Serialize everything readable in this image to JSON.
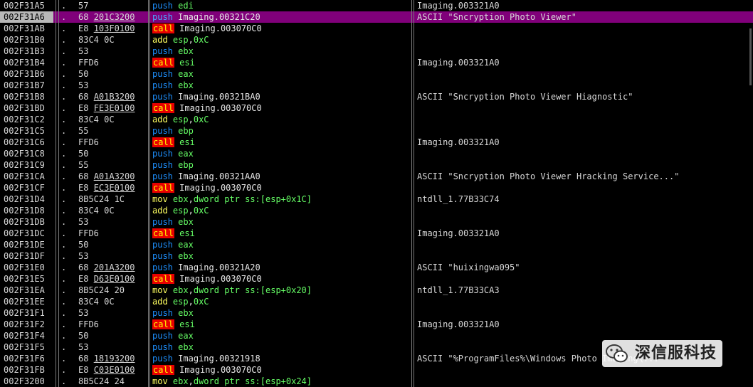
{
  "rows": [
    {
      "addr": "002F31A5",
      "mark": ".",
      "hex": [
        {
          "t": "57"
        }
      ],
      "op": "push",
      "args": [
        {
          "t": "edi",
          "k": "reg"
        }
      ],
      "comment": "Imaging.003321A0"
    },
    {
      "addr": "002F31A6",
      "mark": ".",
      "hex": [
        {
          "t": "68 "
        },
        {
          "t": "201C3200",
          "u": true
        }
      ],
      "op": "push",
      "args": [
        {
          "t": "Imaging.00321C20",
          "k": "lbl"
        }
      ],
      "comment": "ASCII \"Sncryption Photo Viewer\"",
      "selected": true
    },
    {
      "addr": "002F31AB",
      "mark": ".",
      "hex": [
        {
          "t": "E8 "
        },
        {
          "t": "103F0100",
          "u": true
        }
      ],
      "op": "call",
      "args": [
        {
          "t": "Imaging.003070C0",
          "k": "lbl"
        }
      ],
      "comment": ""
    },
    {
      "addr": "002F31B0",
      "mark": ".",
      "hex": [
        {
          "t": "83C4 0C"
        }
      ],
      "op": "add",
      "args": [
        {
          "t": "esp",
          "k": "reg"
        },
        {
          "t": ",",
          "k": "tok"
        },
        {
          "t": "0xC",
          "k": "imm"
        }
      ],
      "comment": ""
    },
    {
      "addr": "002F31B3",
      "mark": ".",
      "hex": [
        {
          "t": "53"
        }
      ],
      "op": "push",
      "args": [
        {
          "t": "ebx",
          "k": "reg"
        }
      ],
      "comment": ""
    },
    {
      "addr": "002F31B4",
      "mark": ".",
      "hex": [
        {
          "t": "FFD6"
        }
      ],
      "op": "call",
      "args": [
        {
          "t": "esi",
          "k": "reg"
        }
      ],
      "comment": "Imaging.003321A0"
    },
    {
      "addr": "002F31B6",
      "mark": ".",
      "hex": [
        {
          "t": "50"
        }
      ],
      "op": "push",
      "args": [
        {
          "t": "eax",
          "k": "reg"
        }
      ],
      "comment": ""
    },
    {
      "addr": "002F31B7",
      "mark": ".",
      "hex": [
        {
          "t": "53"
        }
      ],
      "op": "push",
      "args": [
        {
          "t": "ebx",
          "k": "reg"
        }
      ],
      "comment": ""
    },
    {
      "addr": "002F31B8",
      "mark": ".",
      "hex": [
        {
          "t": "68 "
        },
        {
          "t": "A01B3200",
          "u": true
        }
      ],
      "op": "push",
      "args": [
        {
          "t": "Imaging.00321BA0",
          "k": "lbl"
        }
      ],
      "comment": "ASCII \"Sncryption Photo Viewer Hiagnostic\""
    },
    {
      "addr": "002F31BD",
      "mark": ".",
      "hex": [
        {
          "t": "E8 "
        },
        {
          "t": "FE3E0100",
          "u": true
        }
      ],
      "op": "call",
      "args": [
        {
          "t": "Imaging.003070C0",
          "k": "lbl"
        }
      ],
      "comment": ""
    },
    {
      "addr": "002F31C2",
      "mark": ".",
      "hex": [
        {
          "t": "83C4 0C"
        }
      ],
      "op": "add",
      "args": [
        {
          "t": "esp",
          "k": "reg"
        },
        {
          "t": ",",
          "k": "tok"
        },
        {
          "t": "0xC",
          "k": "imm"
        }
      ],
      "comment": ""
    },
    {
      "addr": "002F31C5",
      "mark": ".",
      "hex": [
        {
          "t": "55"
        }
      ],
      "op": "push",
      "args": [
        {
          "t": "ebp",
          "k": "reg"
        }
      ],
      "comment": ""
    },
    {
      "addr": "002F31C6",
      "mark": ".",
      "hex": [
        {
          "t": "FFD6"
        }
      ],
      "op": "call",
      "args": [
        {
          "t": "esi",
          "k": "reg"
        }
      ],
      "comment": "Imaging.003321A0"
    },
    {
      "addr": "002F31C8",
      "mark": ".",
      "hex": [
        {
          "t": "50"
        }
      ],
      "op": "push",
      "args": [
        {
          "t": "eax",
          "k": "reg"
        }
      ],
      "comment": ""
    },
    {
      "addr": "002F31C9",
      "mark": ".",
      "hex": [
        {
          "t": "55"
        }
      ],
      "op": "push",
      "args": [
        {
          "t": "ebp",
          "k": "reg"
        }
      ],
      "comment": ""
    },
    {
      "addr": "002F31CA",
      "mark": ".",
      "hex": [
        {
          "t": "68 "
        },
        {
          "t": "A01A3200",
          "u": true
        }
      ],
      "op": "push",
      "args": [
        {
          "t": "Imaging.00321AA0",
          "k": "lbl"
        }
      ],
      "comment": "ASCII \"Sncryption Photo Viewer Hracking Service...\""
    },
    {
      "addr": "002F31CF",
      "mark": ".",
      "hex": [
        {
          "t": "E8 "
        },
        {
          "t": "EC3E0100",
          "u": true
        }
      ],
      "op": "call",
      "args": [
        {
          "t": "Imaging.003070C0",
          "k": "lbl"
        }
      ],
      "comment": ""
    },
    {
      "addr": "002F31D4",
      "mark": ".",
      "hex": [
        {
          "t": "8B5C24 1C"
        }
      ],
      "op": "mov",
      "args": [
        {
          "t": "ebx",
          "k": "reg"
        },
        {
          "t": ",",
          "k": "tok"
        },
        {
          "t": "dword ptr ss:[esp+0x1C]",
          "k": "mem"
        }
      ],
      "comment": "ntdll_1.77B33C74"
    },
    {
      "addr": "002F31D8",
      "mark": ".",
      "hex": [
        {
          "t": "83C4 0C"
        }
      ],
      "op": "add",
      "args": [
        {
          "t": "esp",
          "k": "reg"
        },
        {
          "t": ",",
          "k": "tok"
        },
        {
          "t": "0xC",
          "k": "imm"
        }
      ],
      "comment": ""
    },
    {
      "addr": "002F31DB",
      "mark": ".",
      "hex": [
        {
          "t": "53"
        }
      ],
      "op": "push",
      "args": [
        {
          "t": "ebx",
          "k": "reg"
        }
      ],
      "comment": ""
    },
    {
      "addr": "002F31DC",
      "mark": ".",
      "hex": [
        {
          "t": "FFD6"
        }
      ],
      "op": "call",
      "args": [
        {
          "t": "esi",
          "k": "reg"
        }
      ],
      "comment": "Imaging.003321A0"
    },
    {
      "addr": "002F31DE",
      "mark": ".",
      "hex": [
        {
          "t": "50"
        }
      ],
      "op": "push",
      "args": [
        {
          "t": "eax",
          "k": "reg"
        }
      ],
      "comment": ""
    },
    {
      "addr": "002F31DF",
      "mark": ".",
      "hex": [
        {
          "t": "53"
        }
      ],
      "op": "push",
      "args": [
        {
          "t": "ebx",
          "k": "reg"
        }
      ],
      "comment": ""
    },
    {
      "addr": "002F31E0",
      "mark": ".",
      "hex": [
        {
          "t": "68 "
        },
        {
          "t": "201A3200",
          "u": true
        }
      ],
      "op": "push",
      "args": [
        {
          "t": "Imaging.00321A20",
          "k": "lbl"
        }
      ],
      "comment": "ASCII \"huixingwa095\""
    },
    {
      "addr": "002F31E5",
      "mark": ".",
      "hex": [
        {
          "t": "E8 "
        },
        {
          "t": "D63E0100",
          "u": true
        }
      ],
      "op": "call",
      "args": [
        {
          "t": "Imaging.003070C0",
          "k": "lbl"
        }
      ],
      "comment": ""
    },
    {
      "addr": "002F31EA",
      "mark": ".",
      "hex": [
        {
          "t": "8B5C24 20"
        }
      ],
      "op": "mov",
      "args": [
        {
          "t": "ebx",
          "k": "reg"
        },
        {
          "t": ",",
          "k": "tok"
        },
        {
          "t": "dword ptr ss:[esp+0x20]",
          "k": "mem"
        }
      ],
      "comment": "ntdll_1.77B33CA3"
    },
    {
      "addr": "002F31EE",
      "mark": ".",
      "hex": [
        {
          "t": "83C4 0C"
        }
      ],
      "op": "add",
      "args": [
        {
          "t": "esp",
          "k": "reg"
        },
        {
          "t": ",",
          "k": "tok"
        },
        {
          "t": "0xC",
          "k": "imm"
        }
      ],
      "comment": ""
    },
    {
      "addr": "002F31F1",
      "mark": ".",
      "hex": [
        {
          "t": "53"
        }
      ],
      "op": "push",
      "args": [
        {
          "t": "ebx",
          "k": "reg"
        }
      ],
      "comment": ""
    },
    {
      "addr": "002F31F2",
      "mark": ".",
      "hex": [
        {
          "t": "FFD6"
        }
      ],
      "op": "call",
      "args": [
        {
          "t": "esi",
          "k": "reg"
        }
      ],
      "comment": "Imaging.003321A0"
    },
    {
      "addr": "002F31F4",
      "mark": ".",
      "hex": [
        {
          "t": "50"
        }
      ],
      "op": "push",
      "args": [
        {
          "t": "eax",
          "k": "reg"
        }
      ],
      "comment": ""
    },
    {
      "addr": "002F31F5",
      "mark": ".",
      "hex": [
        {
          "t": "53"
        }
      ],
      "op": "push",
      "args": [
        {
          "t": "ebx",
          "k": "reg"
        }
      ],
      "comment": ""
    },
    {
      "addr": "002F31F6",
      "mark": ".",
      "hex": [
        {
          "t": "68 "
        },
        {
          "t": "18193200",
          "u": true
        }
      ],
      "op": "push",
      "args": [
        {
          "t": "Imaging.00321918",
          "k": "lbl"
        }
      ],
      "comment": "ASCII \"%ProgramFiles%\\Windows Photo Imaging\\..."
    },
    {
      "addr": "002F31FB",
      "mark": ".",
      "hex": [
        {
          "t": "E8 "
        },
        {
          "t": "C03E0100",
          "u": true
        }
      ],
      "op": "call",
      "args": [
        {
          "t": "Imaging.003070C0",
          "k": "lbl"
        }
      ],
      "comment": ""
    },
    {
      "addr": "002F3200",
      "mark": ".",
      "hex": [
        {
          "t": "8B5C24 24"
        }
      ],
      "op": "mov",
      "args": [
        {
          "t": "ebx",
          "k": "reg"
        },
        {
          "t": ",",
          "k": "tok"
        },
        {
          "t": "dword ptr ss:[esp+0x24]",
          "k": "mem"
        }
      ],
      "comment": ""
    }
  ],
  "watermark": {
    "icon": "wechat-icon",
    "text": "深信服科技",
    "logo_color": "#3a3a3a"
  },
  "colors": {
    "background": "#000000",
    "selected_row": "#80007a",
    "push": "#1e90ff",
    "call_bg": "#e80000",
    "call_fg": "#ffff00",
    "add_mov": "#ffff60",
    "operand_reg": "#66ff66"
  }
}
